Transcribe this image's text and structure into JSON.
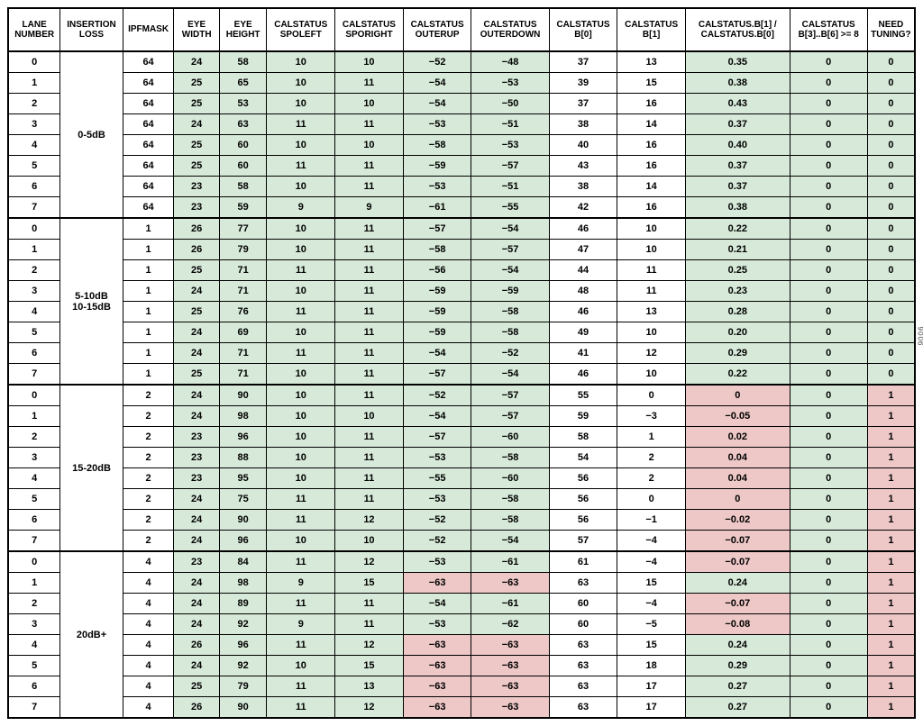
{
  "headers": [
    "LANE NUMBER",
    "INSERTION LOSS",
    "IPFMASK",
    "EYE WIDTH",
    "EYE HEIGHT",
    "CALSTATUS SPOLEFT",
    "CALSTATUS SPORIGHT",
    "CALSTATUS OUTERUP",
    "CALSTATUS OUTERDOWN",
    "CALSTATUS B[0]",
    "CALSTATUS B[1]",
    "CALSTATUS.B[1] / CALSTATUS.B[0]",
    "CALSTATUS B[3]..B[6] >= 8",
    "NEED TUNING?"
  ],
  "groups": [
    {
      "label": "0-5dB",
      "rows": [
        {
          "lane": "0",
          "ipf": "64",
          "ew": "24",
          "eh": "58",
          "spl": "10",
          "spr": "10",
          "ou": "−52",
          "od": "−48",
          "b0": "37",
          "b1": "13",
          "ratio": "0.35",
          "b36": "0",
          "nt": "0",
          "o_flag": false,
          "ratio_flag": false,
          "nt_flag": false
        },
        {
          "lane": "1",
          "ipf": "64",
          "ew": "25",
          "eh": "65",
          "spl": "10",
          "spr": "11",
          "ou": "−54",
          "od": "−53",
          "b0": "39",
          "b1": "15",
          "ratio": "0.38",
          "b36": "0",
          "nt": "0",
          "o_flag": false,
          "ratio_flag": false,
          "nt_flag": false
        },
        {
          "lane": "2",
          "ipf": "64",
          "ew": "25",
          "eh": "53",
          "spl": "10",
          "spr": "10",
          "ou": "−54",
          "od": "−50",
          "b0": "37",
          "b1": "16",
          "ratio": "0.43",
          "b36": "0",
          "nt": "0",
          "o_flag": false,
          "ratio_flag": false,
          "nt_flag": false
        },
        {
          "lane": "3",
          "ipf": "64",
          "ew": "24",
          "eh": "63",
          "spl": "11",
          "spr": "11",
          "ou": "−53",
          "od": "−51",
          "b0": "38",
          "b1": "14",
          "ratio": "0.37",
          "b36": "0",
          "nt": "0",
          "o_flag": false,
          "ratio_flag": false,
          "nt_flag": false
        },
        {
          "lane": "4",
          "ipf": "64",
          "ew": "25",
          "eh": "60",
          "spl": "10",
          "spr": "10",
          "ou": "−58",
          "od": "−53",
          "b0": "40",
          "b1": "16",
          "ratio": "0.40",
          "b36": "0",
          "nt": "0",
          "o_flag": false,
          "ratio_flag": false,
          "nt_flag": false
        },
        {
          "lane": "5",
          "ipf": "64",
          "ew": "25",
          "eh": "60",
          "spl": "11",
          "spr": "11",
          "ou": "−59",
          "od": "−57",
          "b0": "43",
          "b1": "16",
          "ratio": "0.37",
          "b36": "0",
          "nt": "0",
          "o_flag": false,
          "ratio_flag": false,
          "nt_flag": false
        },
        {
          "lane": "6",
          "ipf": "64",
          "ew": "23",
          "eh": "58",
          "spl": "10",
          "spr": "11",
          "ou": "−53",
          "od": "−51",
          "b0": "38",
          "b1": "14",
          "ratio": "0.37",
          "b36": "0",
          "nt": "0",
          "o_flag": false,
          "ratio_flag": false,
          "nt_flag": false
        },
        {
          "lane": "7",
          "ipf": "64",
          "ew": "23",
          "eh": "59",
          "spl": "9",
          "spr": "9",
          "ou": "−61",
          "od": "−55",
          "b0": "42",
          "b1": "16",
          "ratio": "0.38",
          "b36": "0",
          "nt": "0",
          "o_flag": false,
          "ratio_flag": false,
          "nt_flag": false
        }
      ]
    },
    {
      "label": "5-10dB\n10-15dB",
      "rows": [
        {
          "lane": "0",
          "ipf": "1",
          "ew": "26",
          "eh": "77",
          "spl": "10",
          "spr": "11",
          "ou": "−57",
          "od": "−54",
          "b0": "46",
          "b1": "10",
          "ratio": "0.22",
          "b36": "0",
          "nt": "0",
          "o_flag": false,
          "ratio_flag": false,
          "nt_flag": false
        },
        {
          "lane": "1",
          "ipf": "1",
          "ew": "26",
          "eh": "79",
          "spl": "10",
          "spr": "11",
          "ou": "−58",
          "od": "−57",
          "b0": "47",
          "b1": "10",
          "ratio": "0.21",
          "b36": "0",
          "nt": "0",
          "o_flag": false,
          "ratio_flag": false,
          "nt_flag": false
        },
        {
          "lane": "2",
          "ipf": "1",
          "ew": "25",
          "eh": "71",
          "spl": "11",
          "spr": "11",
          "ou": "−56",
          "od": "−54",
          "b0": "44",
          "b1": "11",
          "ratio": "0.25",
          "b36": "0",
          "nt": "0",
          "o_flag": false,
          "ratio_flag": false,
          "nt_flag": false
        },
        {
          "lane": "3",
          "ipf": "1",
          "ew": "24",
          "eh": "71",
          "spl": "10",
          "spr": "11",
          "ou": "−59",
          "od": "−59",
          "b0": "48",
          "b1": "11",
          "ratio": "0.23",
          "b36": "0",
          "nt": "0",
          "o_flag": false,
          "ratio_flag": false,
          "nt_flag": false
        },
        {
          "lane": "4",
          "ipf": "1",
          "ew": "25",
          "eh": "76",
          "spl": "11",
          "spr": "11",
          "ou": "−59",
          "od": "−58",
          "b0": "46",
          "b1": "13",
          "ratio": "0.28",
          "b36": "0",
          "nt": "0",
          "o_flag": false,
          "ratio_flag": false,
          "nt_flag": false
        },
        {
          "lane": "5",
          "ipf": "1",
          "ew": "24",
          "eh": "69",
          "spl": "10",
          "spr": "11",
          "ou": "−59",
          "od": "−58",
          "b0": "49",
          "b1": "10",
          "ratio": "0.20",
          "b36": "0",
          "nt": "0",
          "o_flag": false,
          "ratio_flag": false,
          "nt_flag": false
        },
        {
          "lane": "6",
          "ipf": "1",
          "ew": "24",
          "eh": "71",
          "spl": "11",
          "spr": "11",
          "ou": "−54",
          "od": "−52",
          "b0": "41",
          "b1": "12",
          "ratio": "0.29",
          "b36": "0",
          "nt": "0",
          "o_flag": false,
          "ratio_flag": false,
          "nt_flag": false
        },
        {
          "lane": "7",
          "ipf": "1",
          "ew": "25",
          "eh": "71",
          "spl": "10",
          "spr": "11",
          "ou": "−57",
          "od": "−54",
          "b0": "46",
          "b1": "10",
          "ratio": "0.22",
          "b36": "0",
          "nt": "0",
          "o_flag": false,
          "ratio_flag": false,
          "nt_flag": false
        }
      ]
    },
    {
      "label": "15-20dB",
      "rows": [
        {
          "lane": "0",
          "ipf": "2",
          "ew": "24",
          "eh": "90",
          "spl": "10",
          "spr": "11",
          "ou": "−52",
          "od": "−57",
          "b0": "55",
          "b1": "0",
          "ratio": "0",
          "b36": "0",
          "nt": "1",
          "o_flag": false,
          "ratio_flag": true,
          "nt_flag": true
        },
        {
          "lane": "1",
          "ipf": "2",
          "ew": "24",
          "eh": "98",
          "spl": "10",
          "spr": "10",
          "ou": "−54",
          "od": "−57",
          "b0": "59",
          "b1": "−3",
          "ratio": "−0.05",
          "b36": "0",
          "nt": "1",
          "o_flag": false,
          "ratio_flag": true,
          "nt_flag": true
        },
        {
          "lane": "2",
          "ipf": "2",
          "ew": "23",
          "eh": "96",
          "spl": "10",
          "spr": "11",
          "ou": "−57",
          "od": "−60",
          "b0": "58",
          "b1": "1",
          "ratio": "0.02",
          "b36": "0",
          "nt": "1",
          "o_flag": false,
          "ratio_flag": true,
          "nt_flag": true
        },
        {
          "lane": "3",
          "ipf": "2",
          "ew": "23",
          "eh": "88",
          "spl": "10",
          "spr": "11",
          "ou": "−53",
          "od": "−58",
          "b0": "54",
          "b1": "2",
          "ratio": "0.04",
          "b36": "0",
          "nt": "1",
          "o_flag": false,
          "ratio_flag": true,
          "nt_flag": true
        },
        {
          "lane": "4",
          "ipf": "2",
          "ew": "23",
          "eh": "95",
          "spl": "10",
          "spr": "11",
          "ou": "−55",
          "od": "−60",
          "b0": "56",
          "b1": "2",
          "ratio": "0.04",
          "b36": "0",
          "nt": "1",
          "o_flag": false,
          "ratio_flag": true,
          "nt_flag": true
        },
        {
          "lane": "5",
          "ipf": "2",
          "ew": "24",
          "eh": "75",
          "spl": "11",
          "spr": "11",
          "ou": "−53",
          "od": "−58",
          "b0": "56",
          "b1": "0",
          "ratio": "0",
          "b36": "0",
          "nt": "1",
          "o_flag": false,
          "ratio_flag": true,
          "nt_flag": true
        },
        {
          "lane": "6",
          "ipf": "2",
          "ew": "24",
          "eh": "90",
          "spl": "11",
          "spr": "12",
          "ou": "−52",
          "od": "−58",
          "b0": "56",
          "b1": "−1",
          "ratio": "−0.02",
          "b36": "0",
          "nt": "1",
          "o_flag": false,
          "ratio_flag": true,
          "nt_flag": true
        },
        {
          "lane": "7",
          "ipf": "2",
          "ew": "24",
          "eh": "96",
          "spl": "10",
          "spr": "10",
          "ou": "−52",
          "od": "−54",
          "b0": "57",
          "b1": "−4",
          "ratio": "−0.07",
          "b36": "0",
          "nt": "1",
          "o_flag": false,
          "ratio_flag": true,
          "nt_flag": true
        }
      ]
    },
    {
      "label": "20dB+",
      "rows": [
        {
          "lane": "0",
          "ipf": "4",
          "ew": "23",
          "eh": "84",
          "spl": "11",
          "spr": "12",
          "ou": "−53",
          "od": "−61",
          "b0": "61",
          "b1": "−4",
          "ratio": "−0.07",
          "b36": "0",
          "nt": "1",
          "o_flag": false,
          "ratio_flag": true,
          "nt_flag": true
        },
        {
          "lane": "1",
          "ipf": "4",
          "ew": "24",
          "eh": "98",
          "spl": "9",
          "spr": "15",
          "ou": "−63",
          "od": "−63",
          "b0": "63",
          "b1": "15",
          "ratio": "0.24",
          "b36": "0",
          "nt": "1",
          "o_flag": true,
          "ratio_flag": false,
          "nt_flag": true
        },
        {
          "lane": "2",
          "ipf": "4",
          "ew": "24",
          "eh": "89",
          "spl": "11",
          "spr": "11",
          "ou": "−54",
          "od": "−61",
          "b0": "60",
          "b1": "−4",
          "ratio": "−0.07",
          "b36": "0",
          "nt": "1",
          "o_flag": false,
          "ratio_flag": true,
          "nt_flag": true
        },
        {
          "lane": "3",
          "ipf": "4",
          "ew": "24",
          "eh": "92",
          "spl": "9",
          "spr": "11",
          "ou": "−53",
          "od": "−62",
          "b0": "60",
          "b1": "−5",
          "ratio": "−0.08",
          "b36": "0",
          "nt": "1",
          "o_flag": false,
          "ratio_flag": true,
          "nt_flag": true
        },
        {
          "lane": "4",
          "ipf": "4",
          "ew": "26",
          "eh": "96",
          "spl": "11",
          "spr": "12",
          "ou": "−63",
          "od": "−63",
          "b0": "63",
          "b1": "15",
          "ratio": "0.24",
          "b36": "0",
          "nt": "1",
          "o_flag": true,
          "ratio_flag": false,
          "nt_flag": true
        },
        {
          "lane": "5",
          "ipf": "4",
          "ew": "24",
          "eh": "92",
          "spl": "10",
          "spr": "15",
          "ou": "−63",
          "od": "−63",
          "b0": "63",
          "b1": "18",
          "ratio": "0.29",
          "b36": "0",
          "nt": "1",
          "o_flag": true,
          "ratio_flag": false,
          "nt_flag": true
        },
        {
          "lane": "6",
          "ipf": "4",
          "ew": "25",
          "eh": "79",
          "spl": "11",
          "spr": "13",
          "ou": "−63",
          "od": "−63",
          "b0": "63",
          "b1": "17",
          "ratio": "0.27",
          "b36": "0",
          "nt": "1",
          "o_flag": true,
          "ratio_flag": false,
          "nt_flag": true
        },
        {
          "lane": "7",
          "ipf": "4",
          "ew": "26",
          "eh": "90",
          "spl": "11",
          "spr": "12",
          "ou": "−63",
          "od": "−63",
          "b0": "63",
          "b1": "17",
          "ratio": "0.27",
          "b36": "0",
          "nt": "1",
          "o_flag": true,
          "ratio_flag": false,
          "nt_flag": true
        }
      ]
    }
  ],
  "side_label": "9006"
}
